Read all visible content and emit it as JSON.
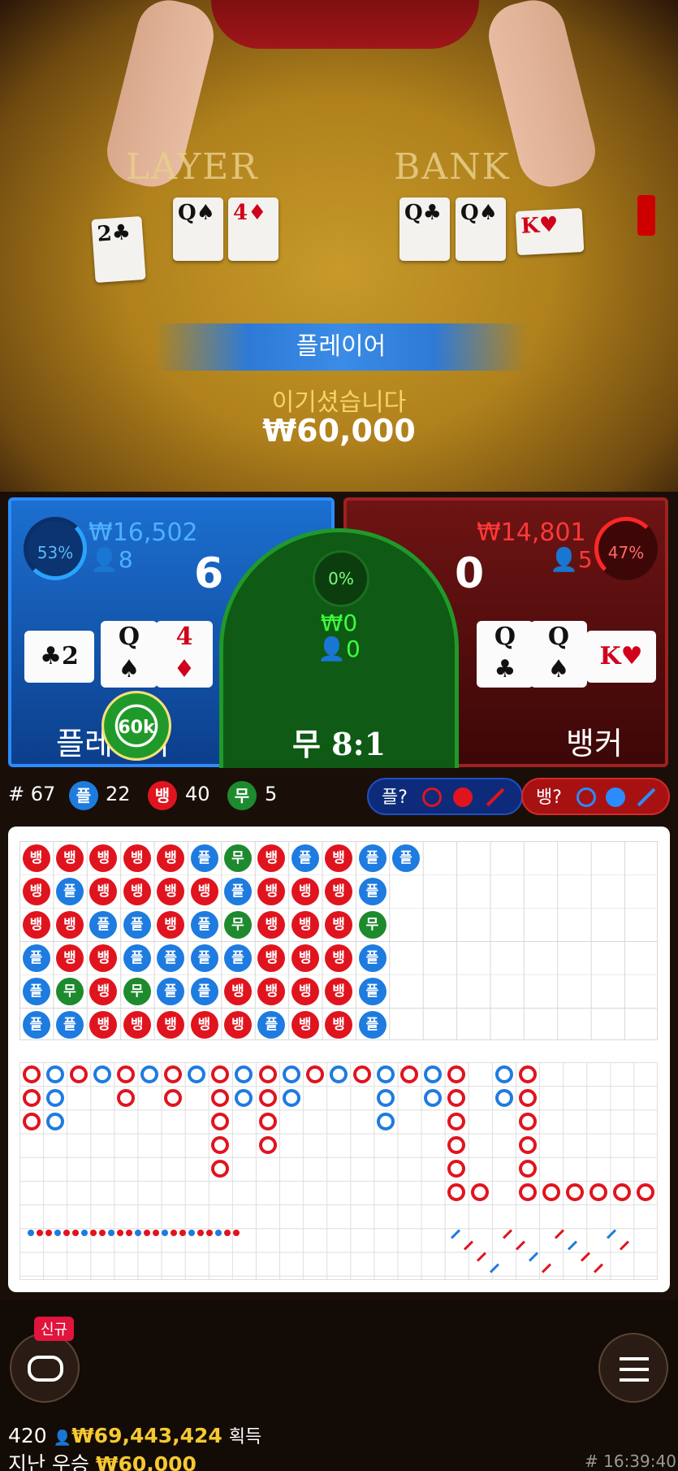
{
  "video": {
    "table_player_label": "LAYER",
    "table_banker_label": "BANK",
    "cards_player": [
      {
        "r": "2",
        "s": "♣",
        "red": false
      },
      {
        "r": "Q",
        "s": "♠",
        "red": false
      },
      {
        "r": "4",
        "s": "♦",
        "red": true
      }
    ],
    "cards_banker": [
      {
        "r": "Q",
        "s": "♣",
        "red": false
      },
      {
        "r": "Q",
        "s": "♠",
        "red": false
      },
      {
        "r": "K",
        "s": "♥",
        "red": true
      }
    ],
    "result_banner": "플레이어",
    "win_label": "이기셨습니다",
    "win_amount": "₩60,000"
  },
  "player": {
    "percent": "53%",
    "amount": "₩16,502",
    "count": "8",
    "score": "6",
    "label": "플레이어",
    "cards": [
      {
        "r": "2",
        "s": "♣",
        "red": false,
        "side": true
      },
      {
        "r": "Q",
        "s": "♠",
        "red": false
      },
      {
        "r": "4",
        "s": "♦",
        "red": true
      }
    ],
    "chip": "60k"
  },
  "tie": {
    "percent": "0%",
    "amount": "₩0",
    "count": "0",
    "label": "무 8:1"
  },
  "banker": {
    "percent": "47%",
    "amount": "₩14,801",
    "count": "5",
    "score": "0",
    "label": "뱅커",
    "cards": [
      {
        "r": "Q",
        "s": "♣",
        "red": false
      },
      {
        "r": "Q",
        "s": "♠",
        "red": false
      },
      {
        "r": "K",
        "s": "♥",
        "red": true,
        "side": true
      }
    ]
  },
  "stats": {
    "round": "# 67",
    "player_label": "플",
    "player_count": "22",
    "banker_label": "뱅",
    "banker_count": "40",
    "tie_label": "무",
    "tie_count": "5",
    "ask_player": "플?",
    "ask_banker": "뱅?"
  },
  "colors": {
    "player": "#1e7be0",
    "banker": "#e0141e",
    "tie": "#1e8a2e"
  },
  "bead_road": [
    [
      "뱅",
      "뱅",
      "뱅",
      "플",
      "플",
      "플"
    ],
    [
      "뱅",
      "플",
      "뱅",
      "뱅",
      "무",
      "플"
    ],
    [
      "뱅",
      "뱅",
      "플",
      "뱅",
      "뱅",
      "뱅"
    ],
    [
      "뱅",
      "뱅",
      "플",
      "플",
      "무",
      "뱅"
    ],
    [
      "뱅",
      "뱅",
      "뱅",
      "플",
      "플",
      "뱅"
    ],
    [
      "플",
      "뱅",
      "플",
      "플",
      "플",
      "뱅"
    ],
    [
      "무",
      "플",
      "무",
      "플",
      "뱅",
      "뱅"
    ],
    [
      "뱅",
      "뱅",
      "뱅",
      "뱅",
      "뱅",
      "플"
    ],
    [
      "플",
      "뱅",
      "뱅",
      "뱅",
      "뱅",
      "뱅"
    ],
    [
      "뱅",
      "뱅",
      "뱅",
      "뱅",
      "뱅",
      "뱅"
    ],
    [
      "플",
      "플",
      "무",
      "플",
      "플",
      "플"
    ],
    [
      "플"
    ]
  ],
  "bottom": {
    "new_badge": "신규",
    "players": "420",
    "total_won": "₩69,443,424",
    "won_label": "획득",
    "last_win_label": "지난 우승",
    "last_win_amount": "₩60,000",
    "time": "# 16:39:40"
  }
}
